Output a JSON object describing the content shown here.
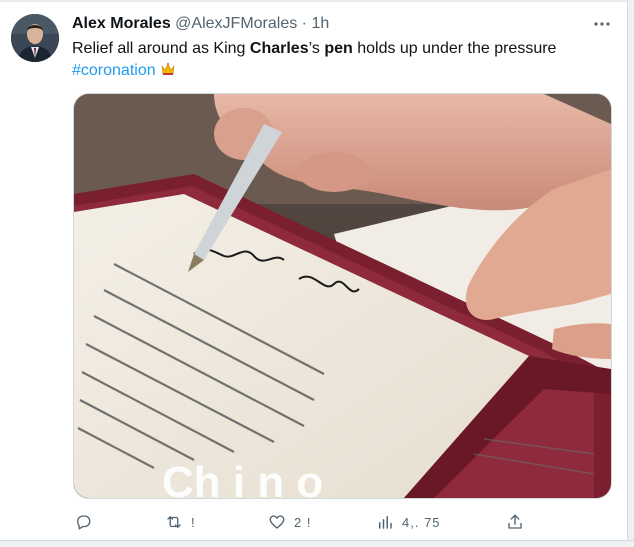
{
  "author": {
    "name": "Alex Morales",
    "handle": "@AlexJFMorales",
    "separator": "·",
    "time": "1h"
  },
  "tweet": {
    "part1": "Relief all around as King ",
    "bold1": "Charles",
    "part2": "’s ",
    "bold2": "pen",
    "part3": " holds up under the pressure",
    "hashtag": "#coronation",
    "emoji_icon": "crown-icon"
  },
  "media": {
    "description_icon": "photo-of-king-signing-oath",
    "overlay_caption": "Ch  i  n  o"
  },
  "actions": {
    "reply_icon": "reply-icon",
    "retweet_count": "!",
    "like_count": "2 !",
    "views_count": "4,. 75",
    "share_icon": "share-icon"
  },
  "colors": {
    "accent": "#1d9bf0",
    "secondary_text": "#536471",
    "primary_text": "#0f1419",
    "binder": "#7a1f2e"
  }
}
